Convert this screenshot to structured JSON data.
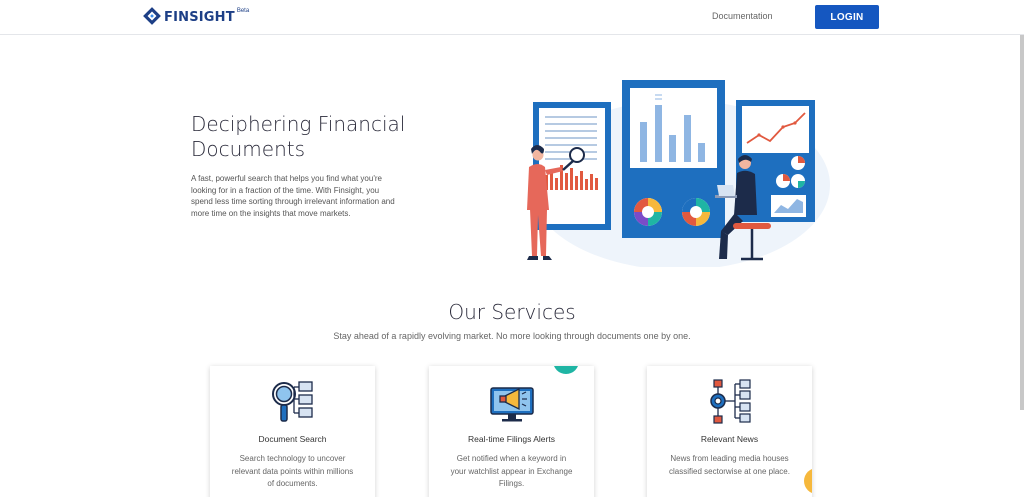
{
  "header": {
    "brand": "FINSIGHT",
    "brand_badge": "Beta",
    "nav_documentation": "Documentation",
    "login_label": "LOGIN"
  },
  "hero": {
    "title": "Deciphering Financial Documents",
    "description": "A fast, powerful search that helps you find what you're looking for in a fraction of the time. With Finsight, you spend less time sorting through irrelevant information and more time on the insights that move markets."
  },
  "services": {
    "title": "Our Services",
    "subtitle": "Stay ahead of a rapidly evolving market. No more looking through documents one by one.",
    "cards": [
      {
        "title": "Document Search",
        "description": "Search technology to uncover relevant data points within millions of documents.",
        "icon": "document-search-icon"
      },
      {
        "title": "Real-time Filings Alerts",
        "description": "Get notified when a keyword in your watchlist appear in Exchange Filings.",
        "icon": "megaphone-monitor-icon"
      },
      {
        "title": "Relevant News",
        "description": "News from leading media houses classified sectorwise at one place.",
        "icon": "gear-network-icon"
      }
    ]
  },
  "colors": {
    "brand": "#1d3f86",
    "primary_button": "#1557c0",
    "illustration_blue": "#1e6fbf",
    "accent_red": "#e1593f",
    "accent_teal": "#1fb5a4",
    "accent_yellow": "#f6b83c"
  }
}
